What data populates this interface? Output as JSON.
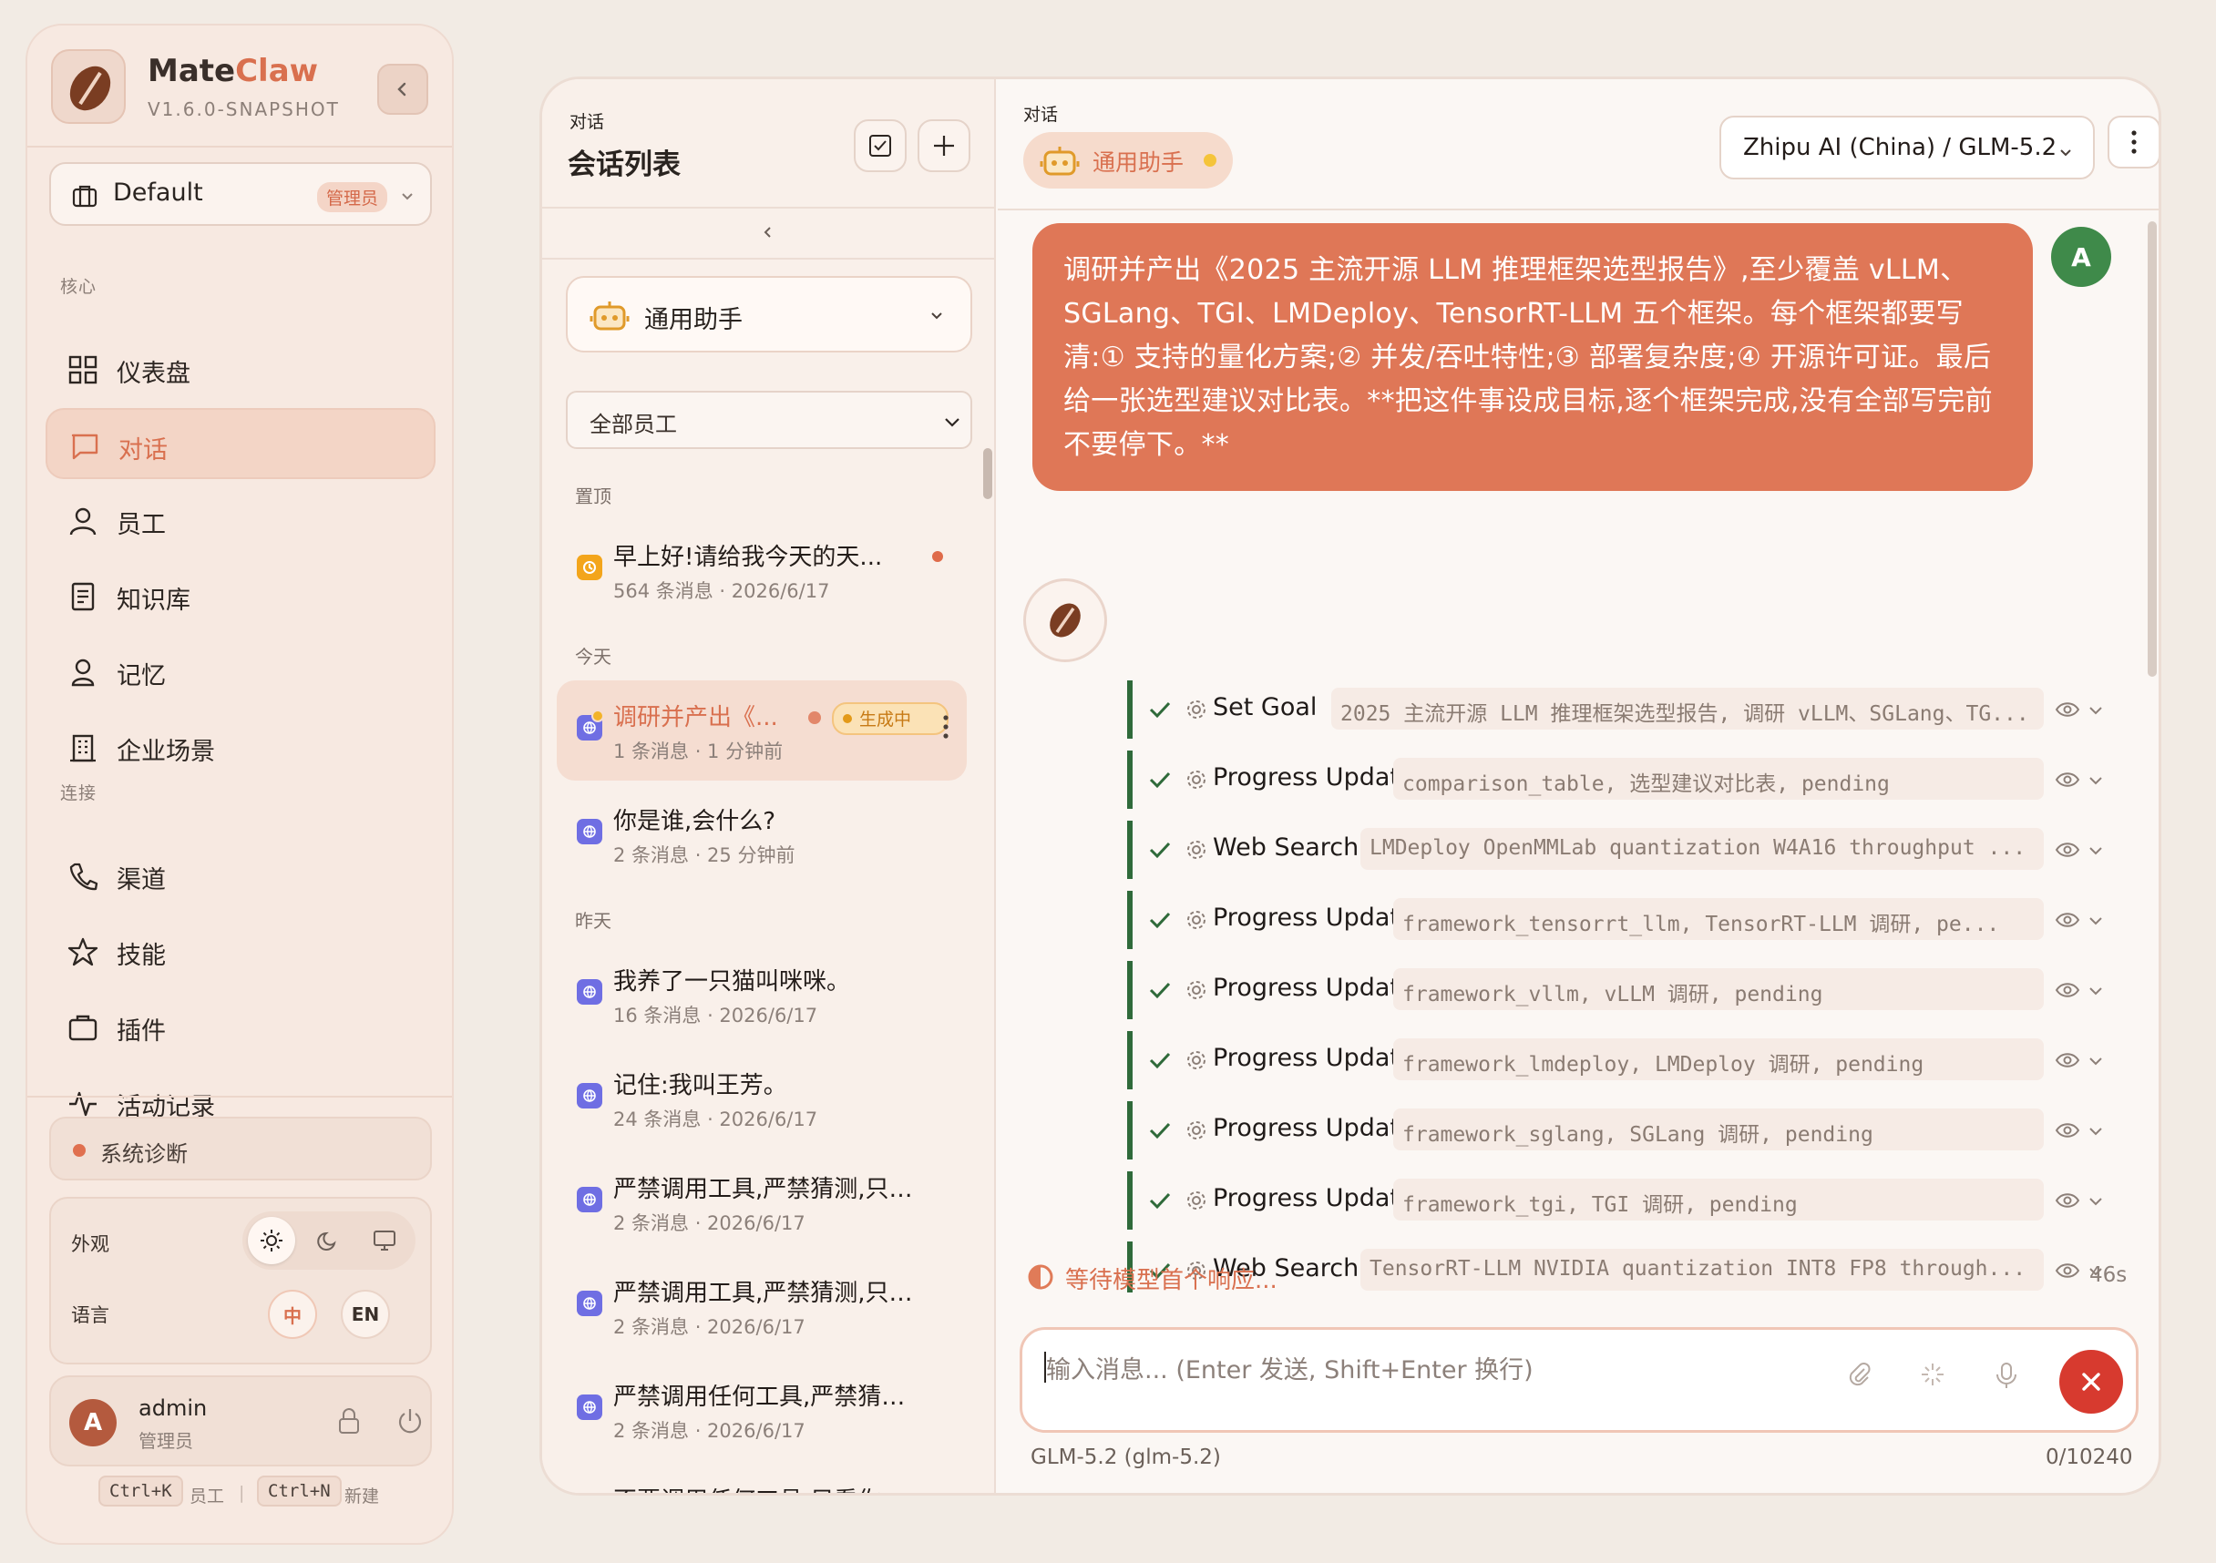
{
  "sidebar": {
    "app_name_prefix": "Mate",
    "app_name_suffix": "Claw",
    "version": "V1.6.0-SNAPSHOT",
    "workspace": {
      "name": "Default",
      "role_badge": "管理员"
    },
    "sections": {
      "core": "核心",
      "connect": "连接"
    },
    "nav": [
      {
        "label": "仪表盘",
        "icon": "grid-icon"
      },
      {
        "label": "对话",
        "icon": "chat-bubble-icon",
        "active": true
      },
      {
        "label": "员工",
        "icon": "user-icon"
      },
      {
        "label": "知识库",
        "icon": "document-icon"
      },
      {
        "label": "记忆",
        "icon": "person-icon"
      },
      {
        "label": "企业场景",
        "icon": "building-icon"
      },
      {
        "label": "渠道",
        "icon": "phone-icon"
      },
      {
        "label": "技能",
        "icon": "star-icon"
      },
      {
        "label": "插件",
        "icon": "briefcase-icon"
      },
      {
        "label": "活动记录",
        "icon": "activity-icon"
      }
    ],
    "diagnostics": "系统诊断",
    "appearance_label": "外观",
    "language_label": "语言",
    "lang_zh": "中",
    "lang_en": "EN",
    "user": {
      "initial": "A",
      "name": "admin",
      "role": "管理员"
    },
    "shortcuts": [
      {
        "key": "Ctrl+K",
        "label": "员工"
      },
      {
        "key": "Ctrl+N",
        "label": "新建"
      }
    ]
  },
  "conversations": {
    "tag": "对话",
    "title": "会话列表",
    "agent": "通用助手",
    "employee_filter": "全部员工",
    "groups": {
      "pinned": "置顶",
      "today": "今天",
      "yesterday": "昨天"
    },
    "items": [
      {
        "title": "早上好!请给我今天的天...",
        "meta": "564 条消息 · 2026/6/17"
      },
      {
        "title": "调研并产出《...",
        "meta": "1 条消息 · 1 分钟前",
        "badge": "生成中"
      },
      {
        "title": "你是谁,会什么?",
        "meta": "2 条消息 · 25 分钟前"
      },
      {
        "title": "我养了一只猫叫咪咪。",
        "meta": "16 条消息 · 2026/6/17"
      },
      {
        "title": "记住:我叫王芳。",
        "meta": "24 条消息 · 2026/6/17"
      },
      {
        "title": "严禁调用工具,严禁猜测,只依...",
        "meta": "2 条消息 · 2026/6/17"
      },
      {
        "title": "严禁调用工具,严禁猜测,只依...",
        "meta": "2 条消息 · 2026/6/17"
      },
      {
        "title": "严禁调用任何工具,严禁猜测...",
        "meta": "2 条消息 · 2026/6/17"
      },
      {
        "title": "不要调用任何工具,只看你系...",
        "meta": ""
      }
    ]
  },
  "chat": {
    "tag": "对话",
    "agent": "通用助手",
    "model": "Zhipu AI (China) / GLM-5.2",
    "user_initial": "A",
    "user_message": "调研并产出《2025 主流开源 LLM 推理框架选型报告》,至少覆盖 vLLM、SGLang、TGI、LMDeploy、TensorRT-LLM 五个框架。每个框架都要写清:① 支持的量化方案;② 并发/吞吐特性;③ 部署复杂度;④ 开源许可证。最后给一张选型建议对比表。**把这件事设成目标,逐个框架完成,没有全部写完前不要停下。**",
    "steps": [
      {
        "name": "Set Goal",
        "args": "2025 主流开源 LLM 推理框架选型报告, 调研 vLLM、SGLang、TG..."
      },
      {
        "name": "Progress Update",
        "args": "comparison_table, 选型建议对比表, pending"
      },
      {
        "name": "Web Search",
        "args": "LMDeploy OpenMMLab quantization W4A16 throughput ..."
      },
      {
        "name": "Progress Update",
        "args": "framework_tensorrt_llm, TensorRT-LLM 调研, pe..."
      },
      {
        "name": "Progress Update",
        "args": "framework_vllm, vLLM 调研, pending"
      },
      {
        "name": "Progress Update",
        "args": "framework_lmdeploy, LMDeploy 调研, pending"
      },
      {
        "name": "Progress Update",
        "args": "framework_sglang, SGLang 调研, pending"
      },
      {
        "name": "Progress Update",
        "args": "framework_tgi, TGI 调研, pending"
      },
      {
        "name": "Web Search",
        "args": "TensorRT-LLM NVIDIA quantization INT8 FP8 through..."
      }
    ],
    "waiting_text": "等待模型首个响应...",
    "elapsed": "46s",
    "input_placeholder": "输入消息... (Enter 发送, Shift+Enter 换行)",
    "footer_model": "GLM-5.2 (glm-5.2)",
    "char_count": "0/10240"
  },
  "colors": {
    "accent": "#d9704f",
    "success": "#2f6a3a",
    "stop": "#d73a2f"
  }
}
